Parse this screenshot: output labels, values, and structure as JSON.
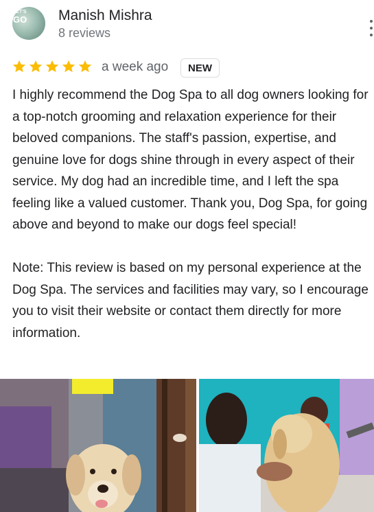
{
  "reviewer": {
    "name": "Manish Mishra",
    "reviews": "8 reviews",
    "avatar_text_top": "LET'S",
    "avatar_text_bottom": "GO"
  },
  "review": {
    "rating": 5,
    "max_rating": 5,
    "time_ago": "a week ago",
    "badge": "NEW",
    "paragraphs": [
      "I highly recommend the Dog Spa to all dog owners looking for a top-notch grooming and relaxation experience for their beloved companions. The staff's passion, expertise, and genuine love for dogs shine through in every aspect of their service. My dog had an incredible time, and I left the spa feeling like a valued customer. Thank you, Dog Spa, for going above and beyond to make our dogs feel special!",
      "Note: This review is based on my personal experience at the Dog Spa. The services and facilities may vary, so I encourage you to visit their website or contact them directly for more information."
    ]
  },
  "icons": {
    "star": "star-icon",
    "menu": "more-vert-icon"
  },
  "colors": {
    "star": "#fbbc04",
    "text": "#202124",
    "secondary": "#70757a"
  }
}
